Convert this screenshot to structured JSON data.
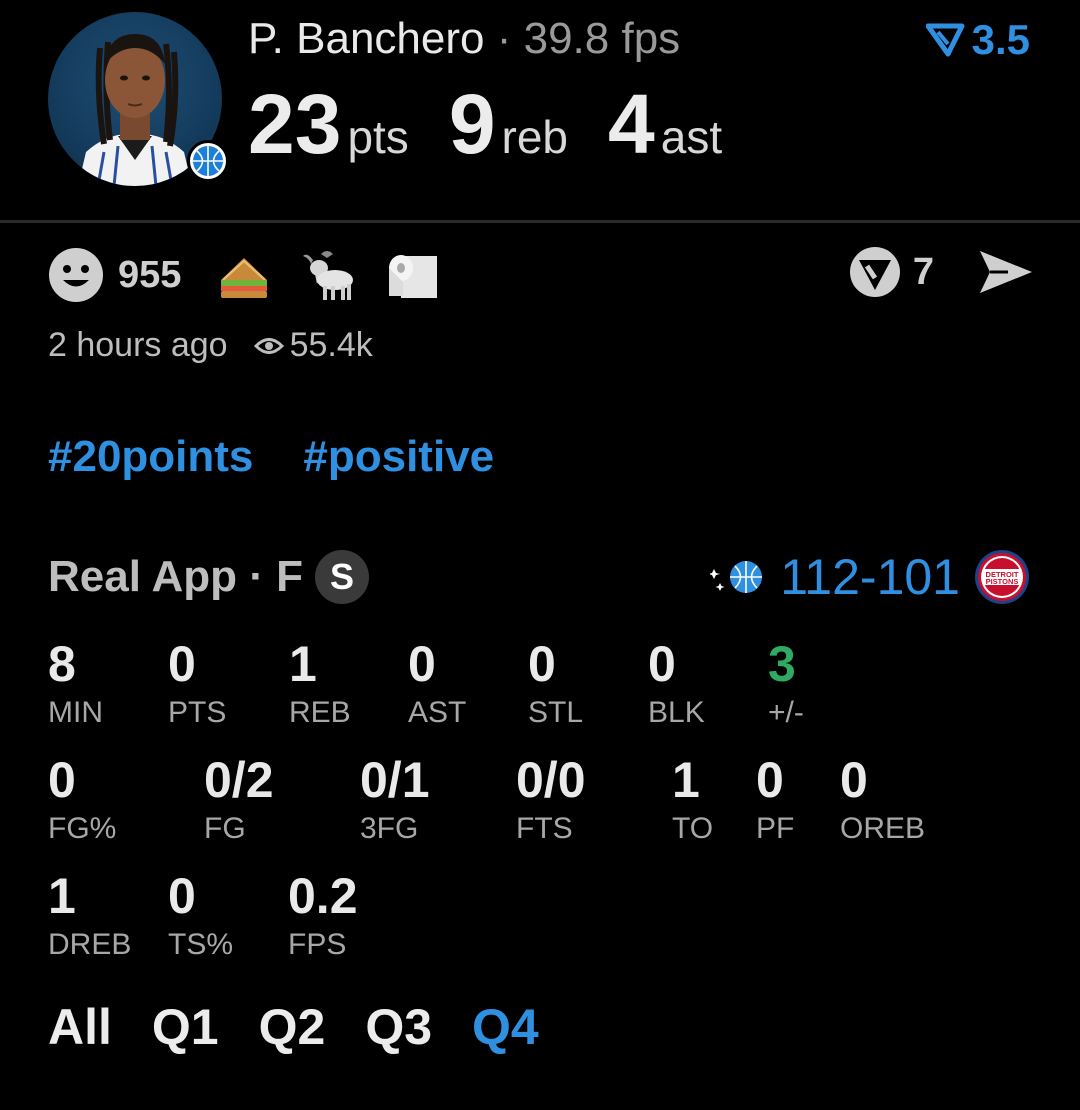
{
  "player": {
    "name": "P. Banchero",
    "separator": "·",
    "fps_text": "39.8 fps",
    "fps_value": "3.5",
    "headline": [
      {
        "value": "23",
        "unit": "pts"
      },
      {
        "value": "9",
        "unit": "reb"
      },
      {
        "value": "4",
        "unit": "ast"
      }
    ]
  },
  "reactions": {
    "count": "955",
    "emojis": [
      "sandwich-emoji",
      "goat-emoji",
      "toilet-paper-emoji"
    ],
    "comments": "7"
  },
  "meta": {
    "time_ago": "2 hours ago",
    "views": "55.4k"
  },
  "hashtags": [
    "#20points",
    "#positive"
  ],
  "game": {
    "app_label": "Real App · F",
    "badge": "S",
    "score": "112-101",
    "away_team_logo": "magic-logo-icon",
    "home_team_logo": "pistons-logo-icon",
    "home_logo_text_1": "DETROIT",
    "home_logo_text_2": "PISTONS"
  },
  "stats": {
    "row1": [
      {
        "label": "MIN",
        "value": "8"
      },
      {
        "label": "PTS",
        "value": "0"
      },
      {
        "label": "REB",
        "value": "1"
      },
      {
        "label": "AST",
        "value": "0"
      },
      {
        "label": "STL",
        "value": "0"
      },
      {
        "label": "BLK",
        "value": "0"
      },
      {
        "label": "+/-",
        "value": "3"
      }
    ],
    "row2": [
      {
        "label": "FG%",
        "value": "0"
      },
      {
        "label": "FG",
        "value": "0/2"
      },
      {
        "label": "3FG",
        "value": "0/1"
      },
      {
        "label": "FTS",
        "value": "0/0"
      },
      {
        "label": "TO",
        "value": "1"
      },
      {
        "label": "PF",
        "value": "0"
      },
      {
        "label": "OREB",
        "value": "0"
      }
    ],
    "row3": [
      {
        "label": "DREB",
        "value": "1"
      },
      {
        "label": "TS%",
        "value": "0"
      },
      {
        "label": "FPS",
        "value": "0.2"
      }
    ]
  },
  "quarters": [
    "All",
    "Q1",
    "Q2",
    "Q3",
    "Q4"
  ],
  "active_quarter": "Q4",
  "colors": {
    "accent": "#2f8fe0",
    "positive": "#2eaa62",
    "background": "#000000"
  }
}
